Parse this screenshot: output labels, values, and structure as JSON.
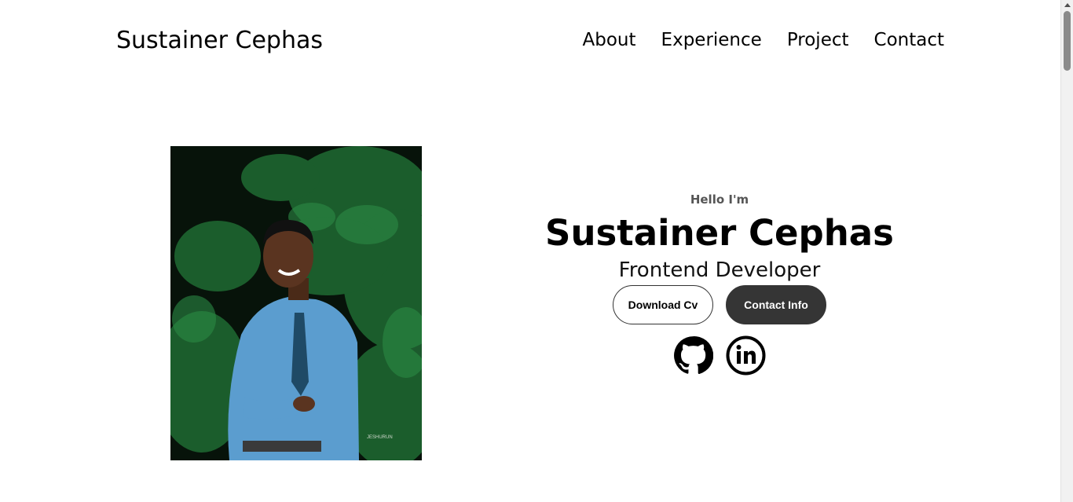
{
  "nav": {
    "logo": "Sustainer Cephas",
    "links": [
      "About",
      "Experience",
      "Project",
      "Contact"
    ]
  },
  "hero": {
    "greeting": "Hello I'm",
    "name": "Sustainer Cephas",
    "role": "Frontend Developer",
    "buttons": {
      "download": "Download Cv",
      "contact": "Contact Info"
    },
    "socials": [
      "github-icon",
      "linkedin-icon"
    ],
    "photo_watermark": "JESHURUN"
  },
  "colors": {
    "dark_button": "#353535",
    "photo_background": "#0a1a0d",
    "foliage": "#1f6b32"
  }
}
